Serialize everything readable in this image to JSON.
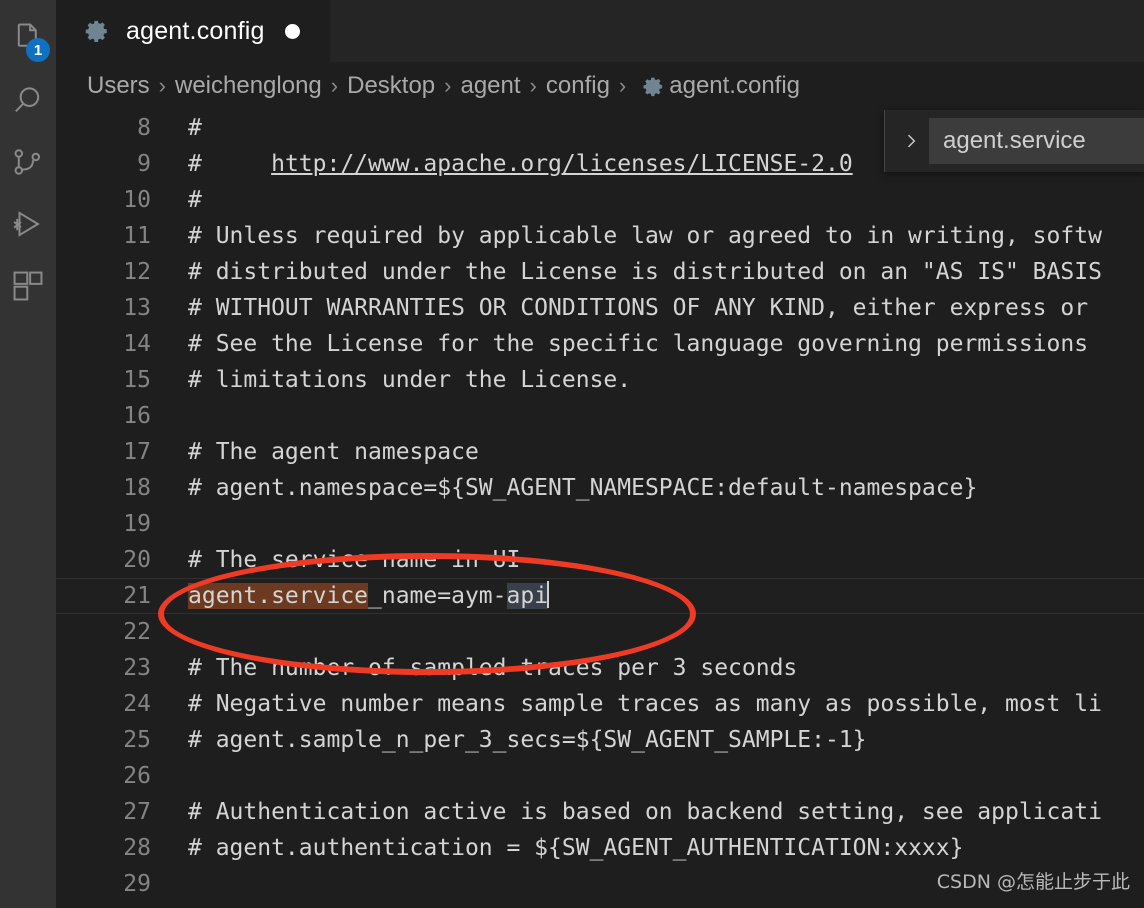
{
  "window": {
    "background": "#1e1e1e"
  },
  "activity_bar": {
    "background": "#333333",
    "items": [
      {
        "name": "explorer",
        "icon": "files-icon",
        "badge": "1",
        "badge_color": "#0f72c0"
      },
      {
        "name": "search",
        "icon": "search-icon",
        "badge": ""
      },
      {
        "name": "source-control",
        "icon": "source-control-icon",
        "badge": ""
      },
      {
        "name": "run-and-debug",
        "icon": "run-debug-icon",
        "badge": ""
      },
      {
        "name": "extensions",
        "icon": "extensions-icon",
        "badge": ""
      }
    ]
  },
  "tab_bar": {
    "active_tab": {
      "icon": "gear-icon",
      "label": "agent.config",
      "dirty": true,
      "dirty_indicator": "●"
    }
  },
  "breadcrumb": {
    "separator": "›",
    "items": [
      {
        "label": "Users"
      },
      {
        "label": "weichenglong"
      },
      {
        "label": "Desktop"
      },
      {
        "label": "agent"
      },
      {
        "label": "config"
      },
      {
        "label": "agent.config",
        "icon": "gear-icon"
      }
    ]
  },
  "breadcrumb_dropdown": {
    "chevron": "›",
    "selected_item": "agent.service",
    "row_background": "#3c3c3c",
    "background": "#252526"
  },
  "editor": {
    "language": "properties",
    "font_size": "23px",
    "current_line": 21,
    "cursor_line": 21,
    "find_match_color": "#6b3a20",
    "selection_color": "#3a4049",
    "lines": [
      {
        "number": "8",
        "segments": [
          {
            "text": "#",
            "style": "plain"
          }
        ]
      },
      {
        "number": "9",
        "segments": [
          {
            "text": "#     ",
            "style": "plain"
          },
          {
            "text": "http://www.apache.org/licenses/LICENSE-2.0",
            "style": "link"
          }
        ]
      },
      {
        "number": "10",
        "segments": [
          {
            "text": "#",
            "style": "plain"
          }
        ]
      },
      {
        "number": "11",
        "segments": [
          {
            "text": "# Unless required by applicable law or agreed to in writing, softw",
            "style": "plain"
          }
        ]
      },
      {
        "number": "12",
        "segments": [
          {
            "text": "# distributed under the License is distributed on an \"AS IS\" BASIS",
            "style": "plain"
          }
        ]
      },
      {
        "number": "13",
        "segments": [
          {
            "text": "# WITHOUT WARRANTIES OR CONDITIONS OF ANY KIND, either express or",
            "style": "plain"
          }
        ]
      },
      {
        "number": "14",
        "segments": [
          {
            "text": "# See the License for the specific language governing permissions",
            "style": "plain"
          }
        ]
      },
      {
        "number": "15",
        "segments": [
          {
            "text": "# limitations under the License.",
            "style": "plain"
          }
        ]
      },
      {
        "number": "16",
        "segments": []
      },
      {
        "number": "17",
        "segments": [
          {
            "text": "# The agent namespace",
            "style": "plain"
          }
        ]
      },
      {
        "number": "18",
        "segments": [
          {
            "text": "# agent.namespace=${SW_AGENT_NAMESPACE:default-namespace}",
            "style": "plain"
          }
        ]
      },
      {
        "number": "19",
        "segments": []
      },
      {
        "number": "20",
        "segments": [
          {
            "text": "# The service name in UI",
            "style": "plain"
          }
        ]
      },
      {
        "number": "21",
        "current": true,
        "segments": [
          {
            "text": "agent.service",
            "style": "find-match"
          },
          {
            "text": "_name=aym-",
            "style": "plain"
          },
          {
            "text": "api",
            "style": "selection"
          },
          {
            "text": "",
            "style": "cursor"
          }
        ]
      },
      {
        "number": "22",
        "segments": []
      },
      {
        "number": "23",
        "segments": [
          {
            "text": "# The number of sampled traces per 3 seconds",
            "style": "plain"
          }
        ]
      },
      {
        "number": "24",
        "segments": [
          {
            "text": "# Negative number means sample traces as many as possible, most li",
            "style": "plain"
          }
        ]
      },
      {
        "number": "25",
        "segments": [
          {
            "text": "# agent.sample_n_per_3_secs=${SW_AGENT_SAMPLE:-1}",
            "style": "plain"
          }
        ]
      },
      {
        "number": "26",
        "segments": []
      },
      {
        "number": "27",
        "segments": [
          {
            "text": "# Authentication active is based on backend setting, see applicati",
            "style": "plain"
          }
        ]
      },
      {
        "number": "28",
        "segments": [
          {
            "text": "# agent.authentication = ${SW_AGENT_AUTHENTICATION:xxxx}",
            "style": "plain"
          }
        ]
      },
      {
        "number": "29",
        "segments": []
      }
    ]
  },
  "annotation": {
    "shape": "ellipse",
    "color": "#ef3b24",
    "targets_line": "21"
  },
  "watermark": {
    "text": "CSDN @怎能止步于此"
  }
}
